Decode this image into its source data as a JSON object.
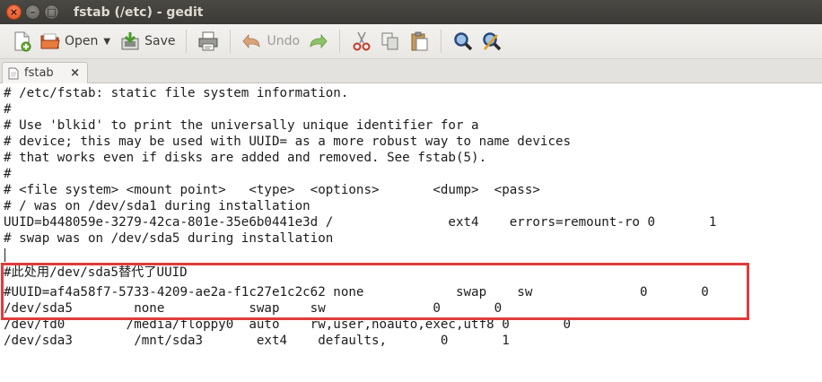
{
  "window": {
    "title": "fstab (/etc) - gedit"
  },
  "toolbar": {
    "open_label": "Open",
    "save_label": "Save",
    "undo_label": "Undo"
  },
  "tab": {
    "label": "fstab",
    "close_glyph": "×"
  },
  "editor": {
    "lines": [
      "# /etc/fstab: static file system information.",
      "#",
      "# Use 'blkid' to print the universally unique identifier for a",
      "# device; this may be used with UUID= as a more robust way to name devices",
      "# that works even if disks are added and removed. See fstab(5).",
      "#",
      "# <file system> <mount point>   <type>  <options>       <dump>  <pass>",
      "# / was on /dev/sda1 during installation",
      "UUID=b448059e-3279-42ca-801e-35e6b0441e3d /               ext4    errors=remount-ro 0       1",
      "# swap was on /dev/sda5 during installation",
      "",
      "#此处用/dev/sda5替代了UUID",
      "#UUID=af4a58f7-5733-4209-ae2a-f1c27e1c2c62 none            swap    sw              0       0",
      "/dev/sda5        none           swap    sw              0       0",
      "/dev/fd0        /media/floppy0  auto    rw,user,noauto,exec,utf8 0       0",
      "/dev/sda3        /mnt/sda3       ext4    defaults,       0       1"
    ]
  },
  "colors": {
    "highlight_border": "#e03c3c",
    "titlebar": "#3b3a36"
  }
}
